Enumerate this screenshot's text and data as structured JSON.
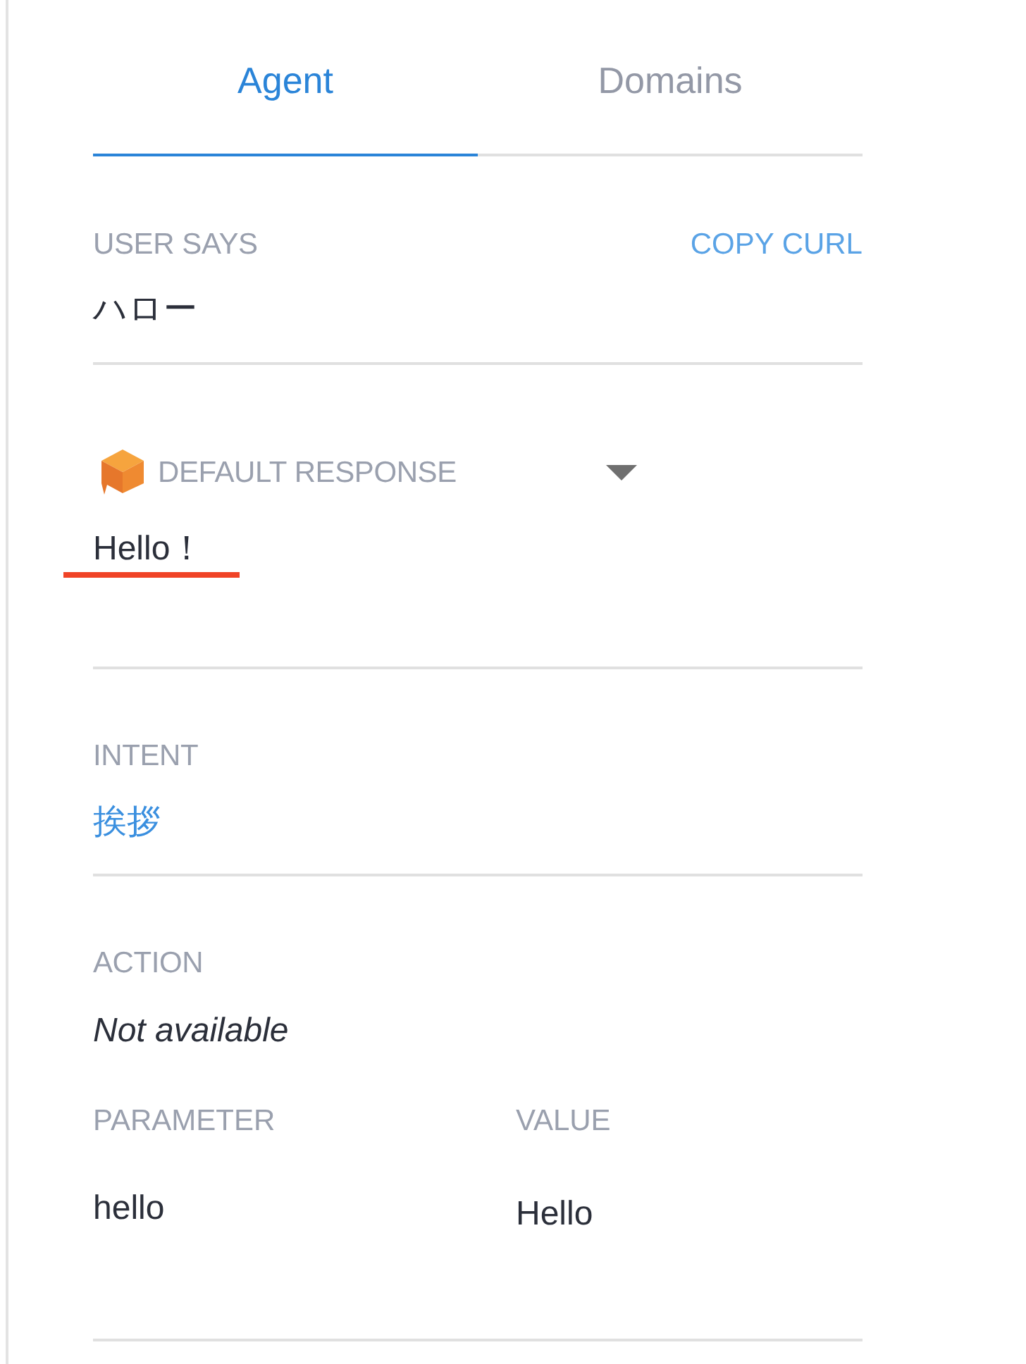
{
  "tabs": [
    {
      "label": "Agent",
      "selected": true
    },
    {
      "label": "Domains",
      "selected": false
    }
  ],
  "user_says": {
    "label": "USER SAYS",
    "link": "COPY CURL",
    "value": "ハロー"
  },
  "default_response": {
    "label": "DEFAULT RESPONSE",
    "value": "Hello！",
    "highlighted": true
  },
  "intent": {
    "label": "INTENT",
    "value": "挨拶"
  },
  "action": {
    "label": "ACTION",
    "value": "Not available"
  },
  "parameters": {
    "columns": [
      "PARAMETER",
      "VALUE"
    ],
    "rows": [
      [
        "hello",
        "Hello"
      ]
    ]
  }
}
